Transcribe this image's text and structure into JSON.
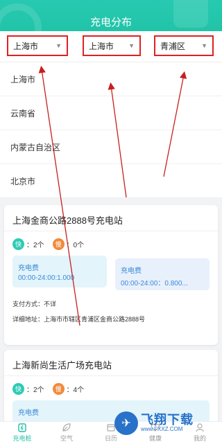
{
  "header": {
    "title": "充电分布"
  },
  "selectors": {
    "province": "上海市",
    "city": "上海市",
    "district": "青浦区"
  },
  "province_list": [
    "上海市",
    "云南省",
    "内蒙古自治区",
    "北京市"
  ],
  "stations": [
    {
      "name": "上海金商公路2888号充电站",
      "fast_label": "快",
      "fast_count": "：2个",
      "slow_label": "慢",
      "slow_count": "：0个",
      "fee_a_title": "充电费",
      "fee_a_value": "00:00-24:00:1.000",
      "fee_b_title": "充电费",
      "fee_b_value": "00:00-24:00：0.800...",
      "payment": "支付方式：不详",
      "address": "详细地址：上海市市辖区青浦区金商公路2888号"
    },
    {
      "name": "上海新尚生活广场充电站",
      "fast_label": "快",
      "fast_count": "：2个",
      "slow_label": "慢",
      "slow_count": "：4个",
      "fee_a_title": "充电费"
    }
  ],
  "tabs": [
    {
      "label": "充电桩",
      "icon": "charge-icon"
    },
    {
      "label": "空气",
      "icon": "leaf-icon"
    },
    {
      "label": "日历",
      "icon": "calendar-icon"
    },
    {
      "label": "健康",
      "icon": "heart-icon"
    },
    {
      "label": "我的",
      "icon": "user-icon"
    }
  ],
  "watermark": {
    "text": "飞翔下载",
    "url": "www.FXXZ.COM"
  },
  "colors": {
    "accent": "#1fc2a5",
    "highlight": "#e02020",
    "fast": "#2ecbb4",
    "slow": "#f08a3c"
  }
}
